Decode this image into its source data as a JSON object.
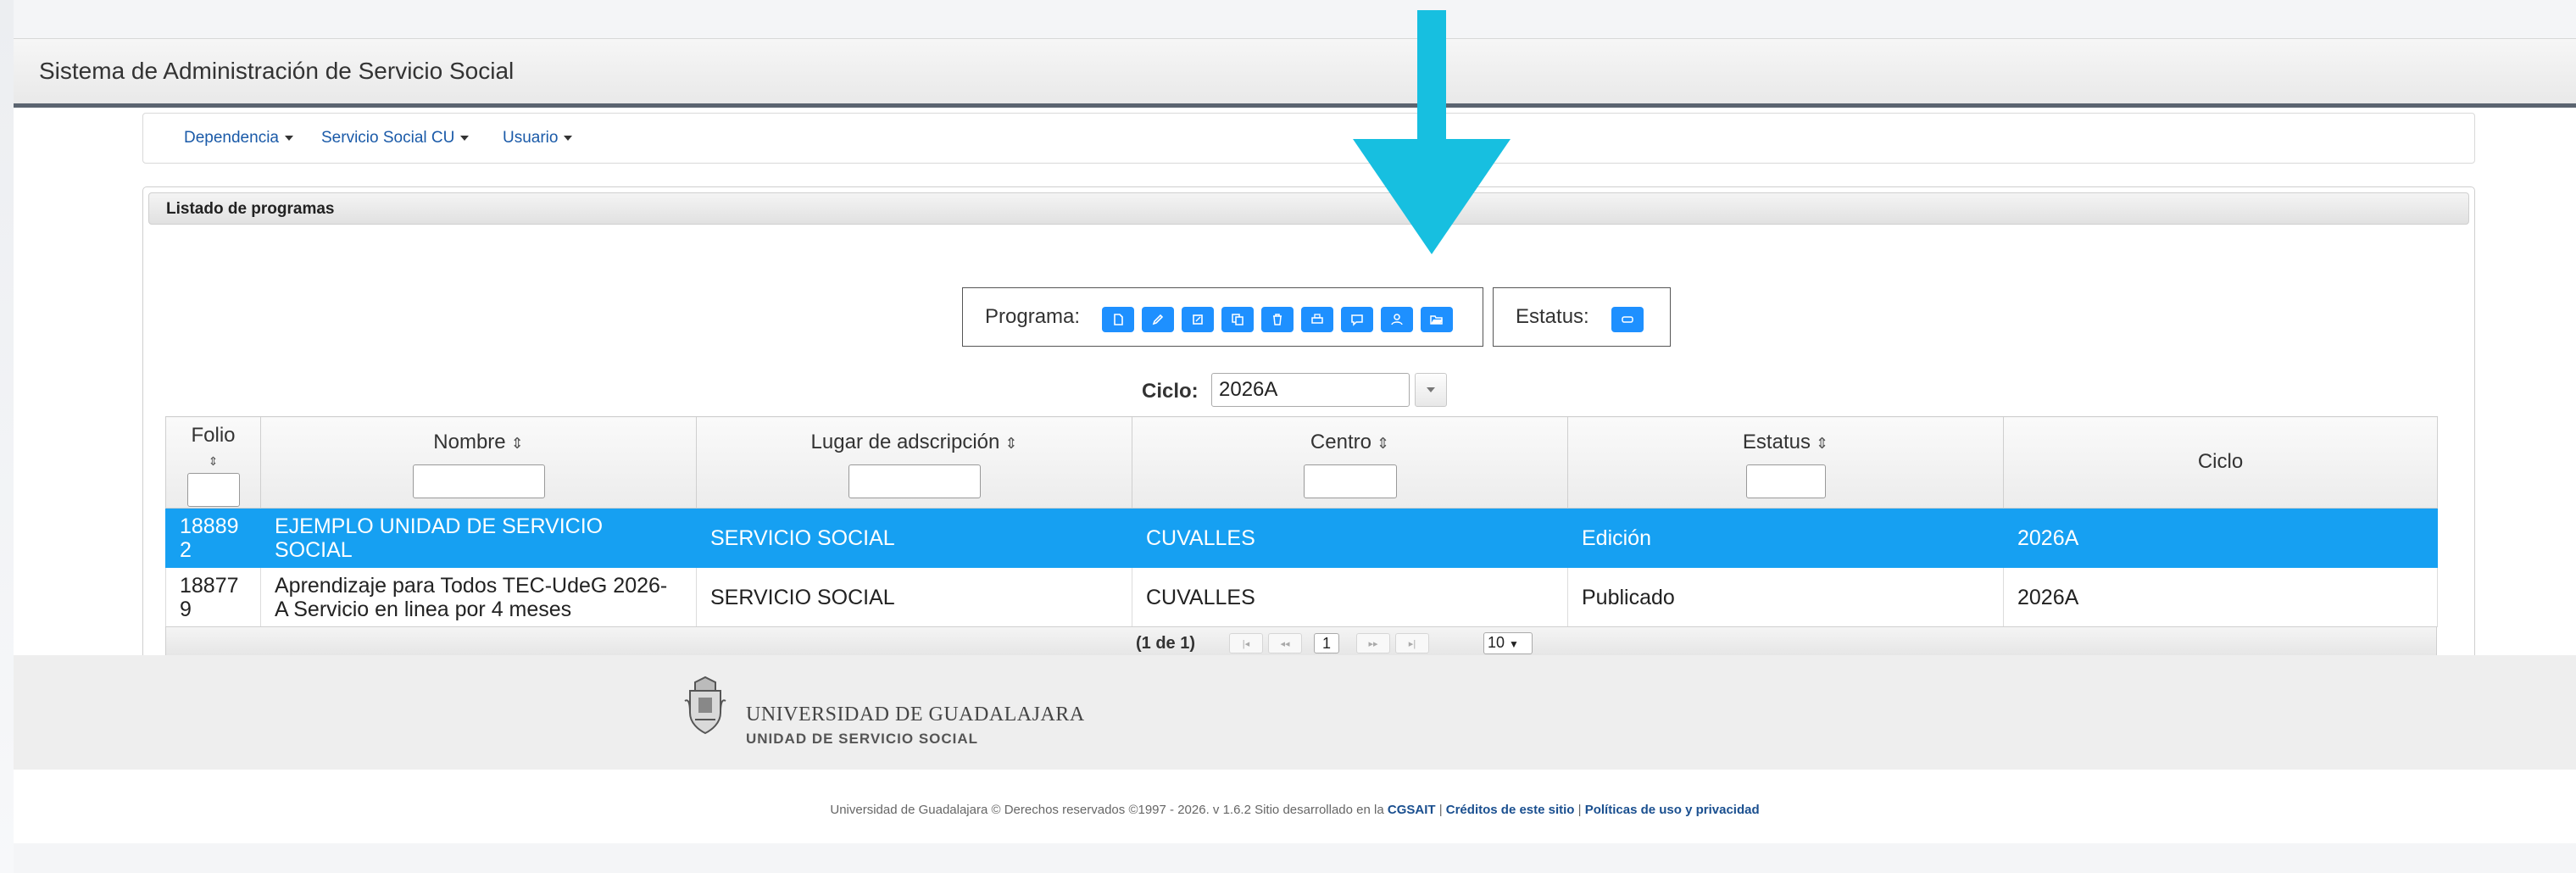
{
  "app": {
    "title": "Sistema de Administración de Servicio Social"
  },
  "nav": {
    "items": [
      {
        "label": "Dependencia"
      },
      {
        "label": "Servicio Social CU"
      },
      {
        "label": "Usuario"
      }
    ]
  },
  "panel": {
    "title": "Listado de programas"
  },
  "toolbar": {
    "programa_label": "Programa:",
    "estatus_label": "Estatus:",
    "programa_buttons": [
      "new-document-icon",
      "edit-icon",
      "edit-box-icon",
      "copy-icon",
      "delete-icon",
      "print-icon",
      "comment-icon",
      "user-icon",
      "folder-open-icon"
    ],
    "estatus_buttons": [
      "status-icon"
    ]
  },
  "ciclo": {
    "label": "Ciclo:",
    "value": "2026A"
  },
  "table": {
    "columns": [
      {
        "label": "Folio",
        "sort": "⇕"
      },
      {
        "label": "Nombre",
        "sort": "⇕"
      },
      {
        "label": "Lugar de adscripción",
        "sort": "⇕"
      },
      {
        "label": "Centro",
        "sort": "⇕"
      },
      {
        "label": "Estatus",
        "sort": "⇕"
      },
      {
        "label": "Ciclo",
        "sort": ""
      }
    ],
    "rows": [
      {
        "folio": "188892",
        "folio_line1": "18889",
        "folio_line2": "2",
        "nombre_line1": "EJEMPLO UNIDAD DE SERVICIO",
        "nombre_line2": "SOCIAL",
        "lugar": "SERVICIO SOCIAL",
        "centro": "CUVALLES",
        "estatus": "Edición",
        "ciclo": "2026A"
      },
      {
        "folio": "188779",
        "folio_line1": "18877",
        "folio_line2": "9",
        "nombre_line1": "Aprendizaje para Todos TEC-UdeG 2026-",
        "nombre_line2": "A Servicio en linea por 4 meses",
        "lugar": "SERVICIO SOCIAL",
        "centro": "CUVALLES",
        "estatus": "Publicado",
        "ciclo": "2026A"
      }
    ]
  },
  "pager": {
    "summary": "(1 de 1)",
    "first": "|◂",
    "prev": "◂◂",
    "page": "1",
    "next": "▸▸",
    "last": "▸|",
    "page_size": "10"
  },
  "footer": {
    "org_name": "UNIVERSIDAD DE GUADALAJARA",
    "org_sub": "UNIDAD DE SERVICIO SOCIAL",
    "copyright": "Universidad de Guadalajara © Derechos reservados ©1997 - 2026. v 1.6.2 Sitio desarrollado en la ",
    "cgsait": "CGSAIT",
    "sep1": " | ",
    "creditos": "Créditos de este sitio",
    "sep2": " | ",
    "politicas": "Políticas de uso y privacidad"
  },
  "colors": {
    "accent": "#1e90ff",
    "selected_row": "#16a0f2",
    "arrow": "#17bfe0",
    "link": "#1a5aa8"
  }
}
